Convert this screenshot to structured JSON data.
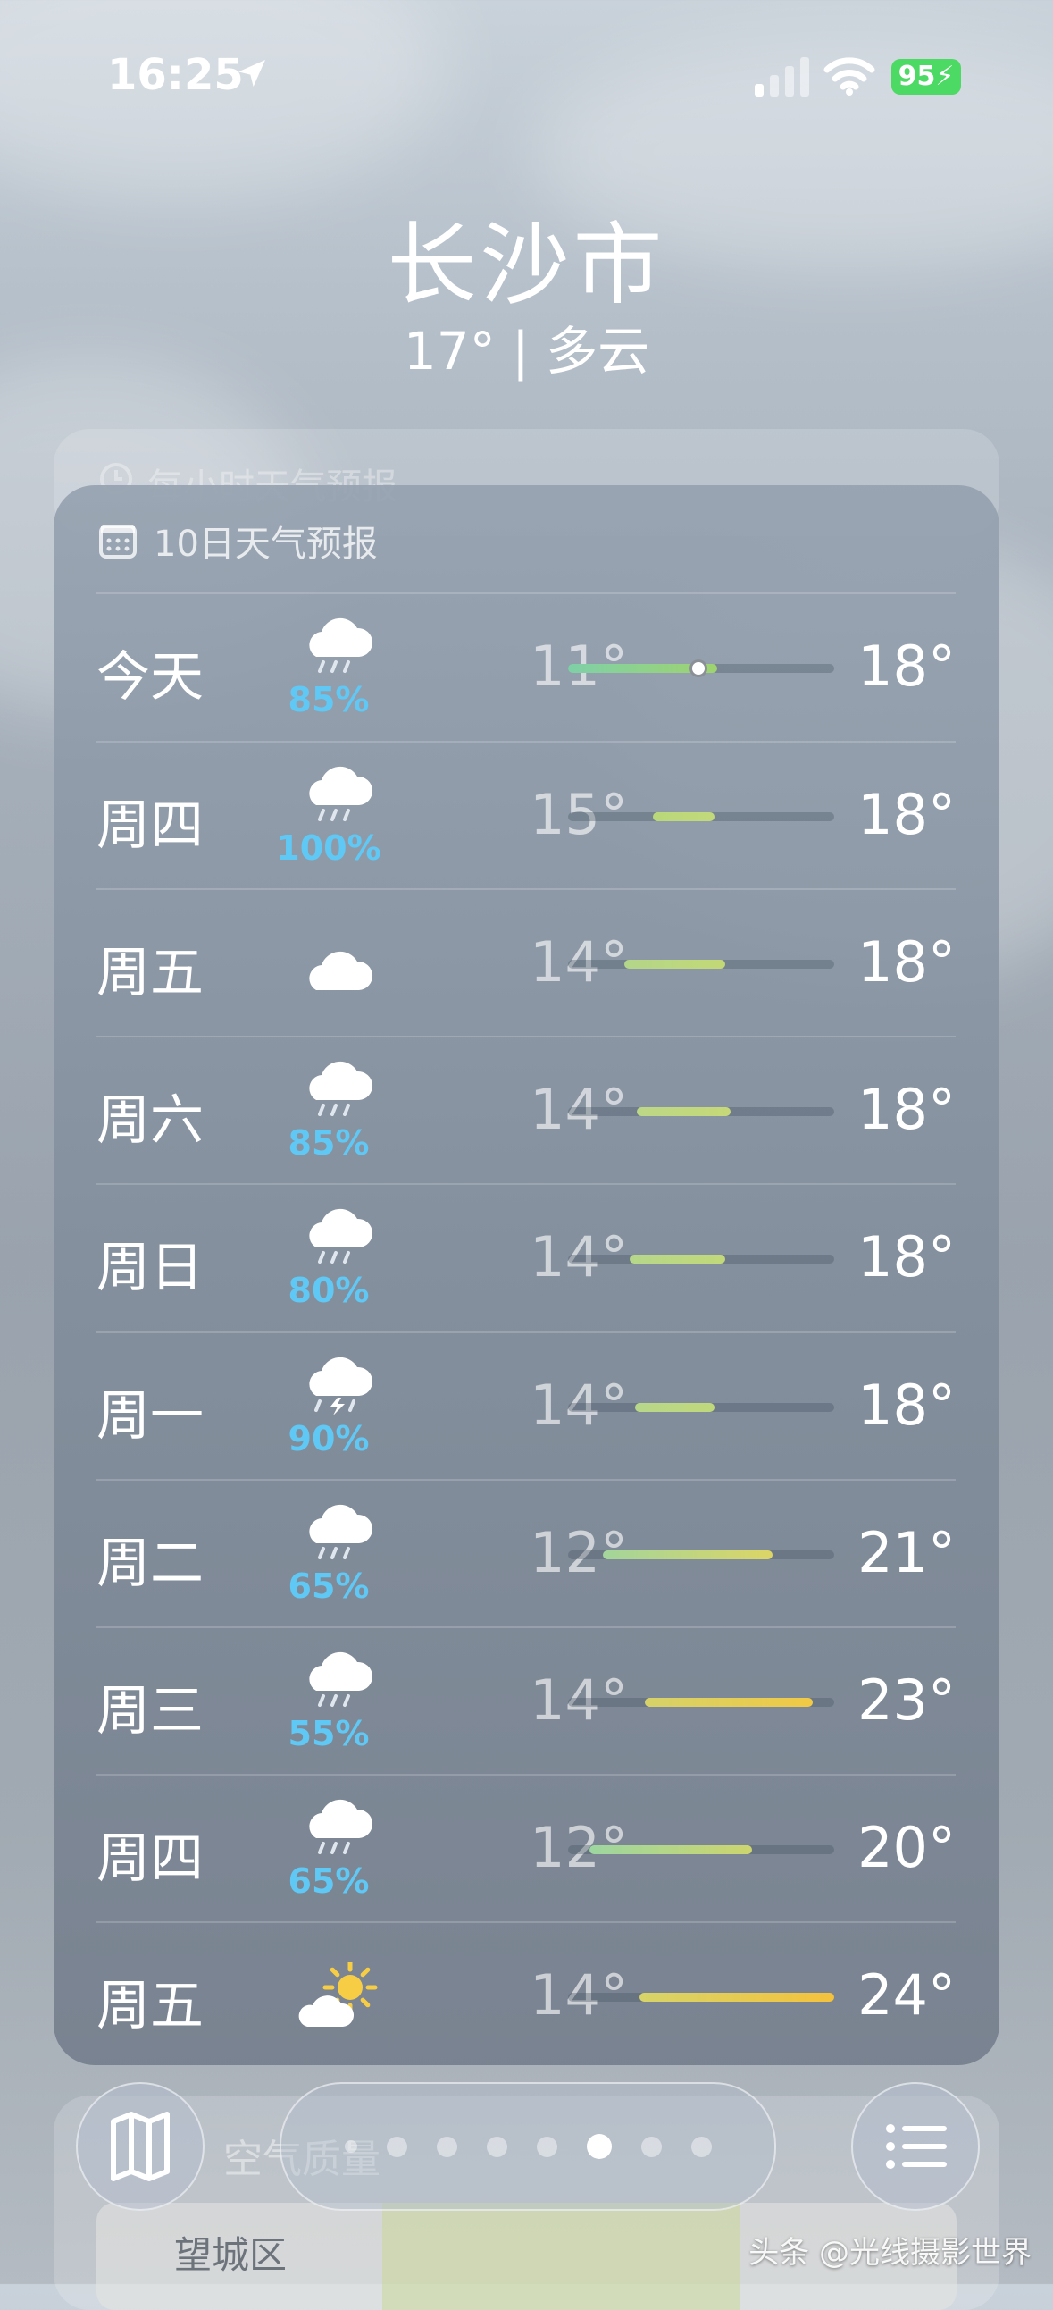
{
  "status_bar": {
    "time": "16:25",
    "battery": "95"
  },
  "header": {
    "city": "长沙市",
    "subtitle": "17° | 多云"
  },
  "hourly_card": {
    "title": "每小时天气预报"
  },
  "forecast": {
    "title": "10日天气预报",
    "days": [
      {
        "day": "今天",
        "icon": "cloud-rain-icon",
        "prob": "85%",
        "low": "11°",
        "high": "18°",
        "range": [
          0,
          0.56
        ],
        "current": 0.49,
        "colors": [
          "#7fd0a8",
          "#9fd36f"
        ]
      },
      {
        "day": "周四",
        "icon": "cloud-rain-icon",
        "prob": "100%",
        "low": "15°",
        "high": "18°",
        "range": [
          0.32,
          0.55
        ],
        "colors": [
          "#b9d879",
          "#c2d97b"
        ]
      },
      {
        "day": "周五",
        "icon": "cloud-icon",
        "prob": "",
        "low": "14°",
        "high": "18°",
        "range": [
          0.21,
          0.59
        ],
        "colors": [
          "#b3d68a",
          "#c3d876"
        ]
      },
      {
        "day": "周六",
        "icon": "cloud-rain-icon",
        "prob": "85%",
        "low": "14°",
        "high": "18°",
        "range": [
          0.26,
          0.61
        ],
        "colors": [
          "#bcd787",
          "#c6d878"
        ]
      },
      {
        "day": "周日",
        "icon": "cloud-rain-icon",
        "prob": "80%",
        "low": "14°",
        "high": "18°",
        "range": [
          0.23,
          0.59
        ],
        "colors": [
          "#b6d78a",
          "#c2d87a"
        ]
      },
      {
        "day": "周一",
        "icon": "cloud-lightning-rain-icon",
        "prob": "90%",
        "low": "14°",
        "high": "18°",
        "range": [
          0.25,
          0.55
        ],
        "colors": [
          "#b8d78a",
          "#c0d87c"
        ]
      },
      {
        "day": "周二",
        "icon": "cloud-rain-icon",
        "prob": "65%",
        "low": "12°",
        "high": "21°",
        "range": [
          0.13,
          0.77
        ],
        "colors": [
          "#a3d59b",
          "#dcd566"
        ]
      },
      {
        "day": "周三",
        "icon": "cloud-rain-icon",
        "prob": "55%",
        "low": "14°",
        "high": "23°",
        "range": [
          0.29,
          0.92
        ],
        "colors": [
          "#d5d26a",
          "#f1c945"
        ]
      },
      {
        "day": "周四",
        "icon": "cloud-rain-icon",
        "prob": "65%",
        "low": "12°",
        "high": "20°",
        "range": [
          0.08,
          0.69
        ],
        "colors": [
          "#9dd6a0",
          "#cdd56e"
        ]
      },
      {
        "day": "周五",
        "icon": "partly-cloudy-sun-icon",
        "prob": "",
        "low": "14°",
        "high": "24°",
        "range": [
          0.27,
          1.0
        ],
        "colors": [
          "#d7d469",
          "#f5c23c"
        ]
      }
    ]
  },
  "air_quality": {
    "title": "空气质量",
    "district": "望城区"
  },
  "page_dots": {
    "count": 8,
    "active": 5
  },
  "watermark": "头条 @光线摄影世界"
}
